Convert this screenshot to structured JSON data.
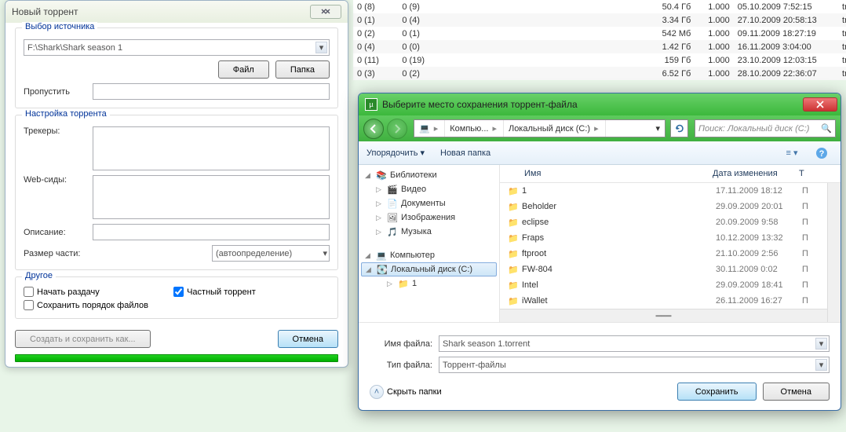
{
  "bg_rows": [
    {
      "c1": "0 (8)",
      "c2": "0 (9)",
      "c4": "50.4 Гб",
      "c5": "1.000",
      "c6": "05.10.2009 7:52:15",
      "c7": "tracker.bee-..."
    },
    {
      "c1": "0 (1)",
      "c2": "0 (4)",
      "c4": "3.34 Гб",
      "c5": "1.000",
      "c6": "27.10.2009 20:58:13",
      "c7": "tracker.bee-..."
    },
    {
      "c1": "0 (2)",
      "c2": "0 (1)",
      "c4": "542 Мб",
      "c5": "1.000",
      "c6": "09.11.2009 18:27:19",
      "c7": "tracker.bee-..."
    },
    {
      "c1": "0 (4)",
      "c2": "0 (0)",
      "c4": "1.42 Гб",
      "c5": "1.000",
      "c6": "16.11.2009 3:04:00",
      "c7": "tracker.bee-..."
    },
    {
      "c1": "0 (11)",
      "c2": "0 (19)",
      "c4": "159 Гб",
      "c5": "1.000",
      "c6": "23.10.2009 12:03:15",
      "c7": "tracker.bee-..."
    },
    {
      "c1": "0 (3)",
      "c2": "0 (2)",
      "c4": "6.52 Гб",
      "c5": "1.000",
      "c6": "28.10.2009 22:36:07",
      "c7": "tracker.bee-..."
    }
  ],
  "dlg1": {
    "title": "Новый торрент",
    "source_legend": "Выбор источника",
    "path": "F:\\Shark\\Shark season 1",
    "file_btn": "Файл",
    "folder_btn": "Папка",
    "skip_label": "Пропустить",
    "settings_legend": "Настройка торрента",
    "trackers": "Трекеры:",
    "webseeds": "Web-сиды:",
    "desc": "Описание:",
    "piece_size": "Размер части:",
    "piece_auto": "(автоопределение)",
    "other_legend": "Другое",
    "start_seed": "Начать раздачу",
    "private": "Частный торрент",
    "preserve": "Сохранить порядок файлов",
    "save_as": "Создать и сохранить как...",
    "cancel": "Отмена"
  },
  "dlg2": {
    "title": "Выберите место сохранения торрент-файла",
    "bc": [
      "Компью...",
      "Локальный диск (C:)"
    ],
    "search_ph": "Поиск: Локальный диск (C:)",
    "organize": "Упорядочить",
    "new_folder": "Новая папка",
    "col_name": "Имя",
    "col_date": "Дата изменения",
    "col_type": "Т",
    "tree": {
      "libraries": "Библиотеки",
      "videos": "Видео",
      "docs": "Документы",
      "images": "Изображения",
      "music": "Музыка",
      "computer": "Компьютер",
      "disk_c": "Локальный диск (C:)",
      "folder1": "1"
    },
    "files": [
      {
        "name": "1",
        "date": "17.11.2009 18:12",
        "type": "П"
      },
      {
        "name": "Beholder",
        "date": "29.09.2009 20:01",
        "type": "П"
      },
      {
        "name": "eclipse",
        "date": "20.09.2009 9:58",
        "type": "П"
      },
      {
        "name": "Fraps",
        "date": "10.12.2009 13:32",
        "type": "П"
      },
      {
        "name": "ftproot",
        "date": "21.10.2009 2:56",
        "type": "П"
      },
      {
        "name": "FW-804",
        "date": "30.11.2009 0:02",
        "type": "П"
      },
      {
        "name": "Intel",
        "date": "29.09.2009 18:41",
        "type": "П"
      },
      {
        "name": "iWallet",
        "date": "26.11.2009 16:27",
        "type": "П"
      }
    ],
    "filename_label": "Имя файла:",
    "filename": "Shark season 1.torrent",
    "filetype_label": "Тип файла:",
    "filetype": "Торрент-файлы",
    "hide_folders": "Скрыть папки",
    "save": "Сохранить",
    "cancel": "Отмена"
  }
}
